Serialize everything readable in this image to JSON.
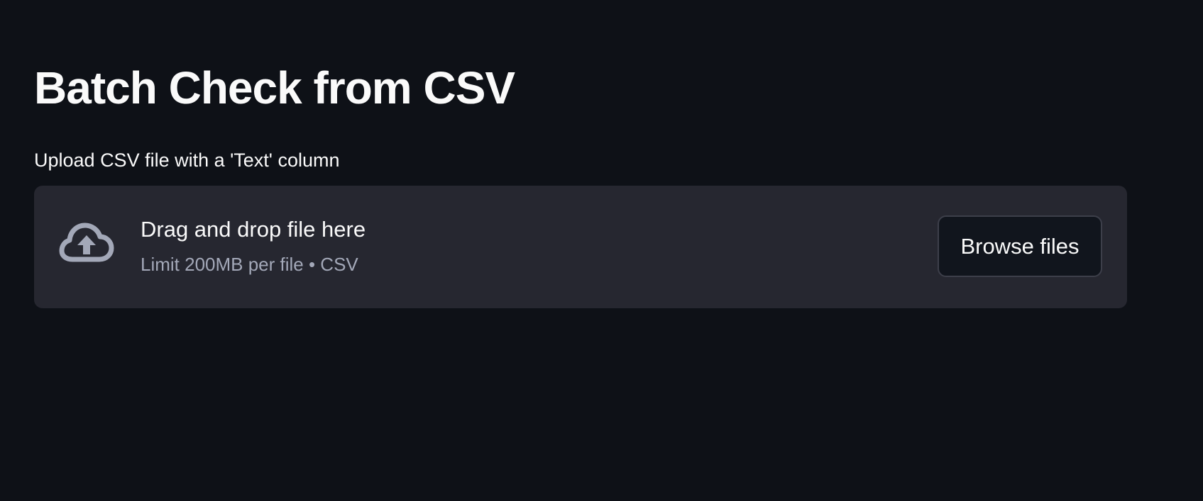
{
  "page": {
    "title": "Batch Check from CSV"
  },
  "uploader": {
    "label": "Upload CSV file with a 'Text' column",
    "drop_title": "Drag and drop file here",
    "drop_hint": "Limit 200MB per file • CSV",
    "browse_label": "Browse files",
    "icon": "cloud-upload-icon"
  },
  "colors": {
    "background": "#0e1117",
    "dropzone": "#262730",
    "text": "#fafafa",
    "muted_text": "#a3a8b8",
    "icon": "#a3a8b8",
    "button_background": "#11151d",
    "button_border": "#3d3f4a"
  }
}
